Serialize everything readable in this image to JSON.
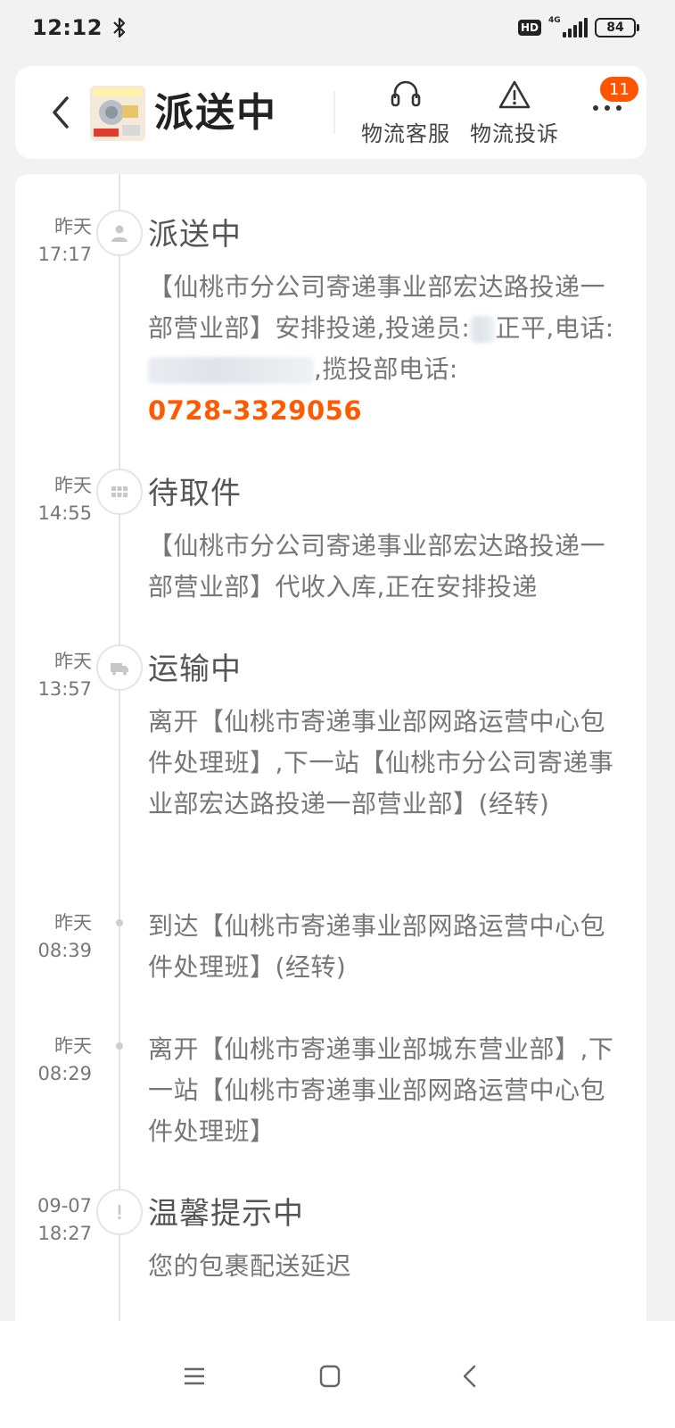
{
  "status_bar": {
    "time": "12:12",
    "hd_label": "HD",
    "network_label": "4G",
    "battery_level": "84"
  },
  "header": {
    "title": "派送中",
    "actions": [
      {
        "label": "物流客服",
        "icon": "headset-icon"
      },
      {
        "label": "物流投诉",
        "icon": "warning-icon"
      }
    ],
    "notification_count": "11"
  },
  "timeline": [
    {
      "date": "昨天",
      "time": "17:17",
      "status": "派送中",
      "icon": "person-icon",
      "text_parts": [
        "【仙桃市分公司寄递事业部宏达路投递一部营业部】安排投递,投递员:",
        "正平,电话:",
        ",揽投部电话:"
      ],
      "phone": "0728-3329056"
    },
    {
      "date": "昨天",
      "time": "14:55",
      "status": "待取件",
      "icon": "grid-icon",
      "text": "【仙桃市分公司寄递事业部宏达路投递一部营业部】代收入库,正在安排投递"
    },
    {
      "date": "昨天",
      "time": "13:57",
      "status": "运输中",
      "icon": "truck-icon",
      "text": "离开【仙桃市寄递事业部网路运营中心包件处理班】,下一站【仙桃市分公司寄递事业部宏达路投递一部营业部】(经转)"
    },
    {
      "date": "昨天",
      "time": "08:39",
      "text": "到达【仙桃市寄递事业部网路运营中心包件处理班】(经转)"
    },
    {
      "date": "昨天",
      "time": "08:29",
      "text": "离开【仙桃市寄递事业部城东营业部】,下一站【仙桃市寄递事业部网路运营中心包件处理班】"
    },
    {
      "date": "09-07",
      "time": "18:27",
      "status": "温馨提示中",
      "icon": "exclamation-icon",
      "text": "您的包裹配送延迟"
    }
  ],
  "colors": {
    "accent": "#ff5a00",
    "badge": "#ff5500",
    "background": "#f2f2f2"
  }
}
